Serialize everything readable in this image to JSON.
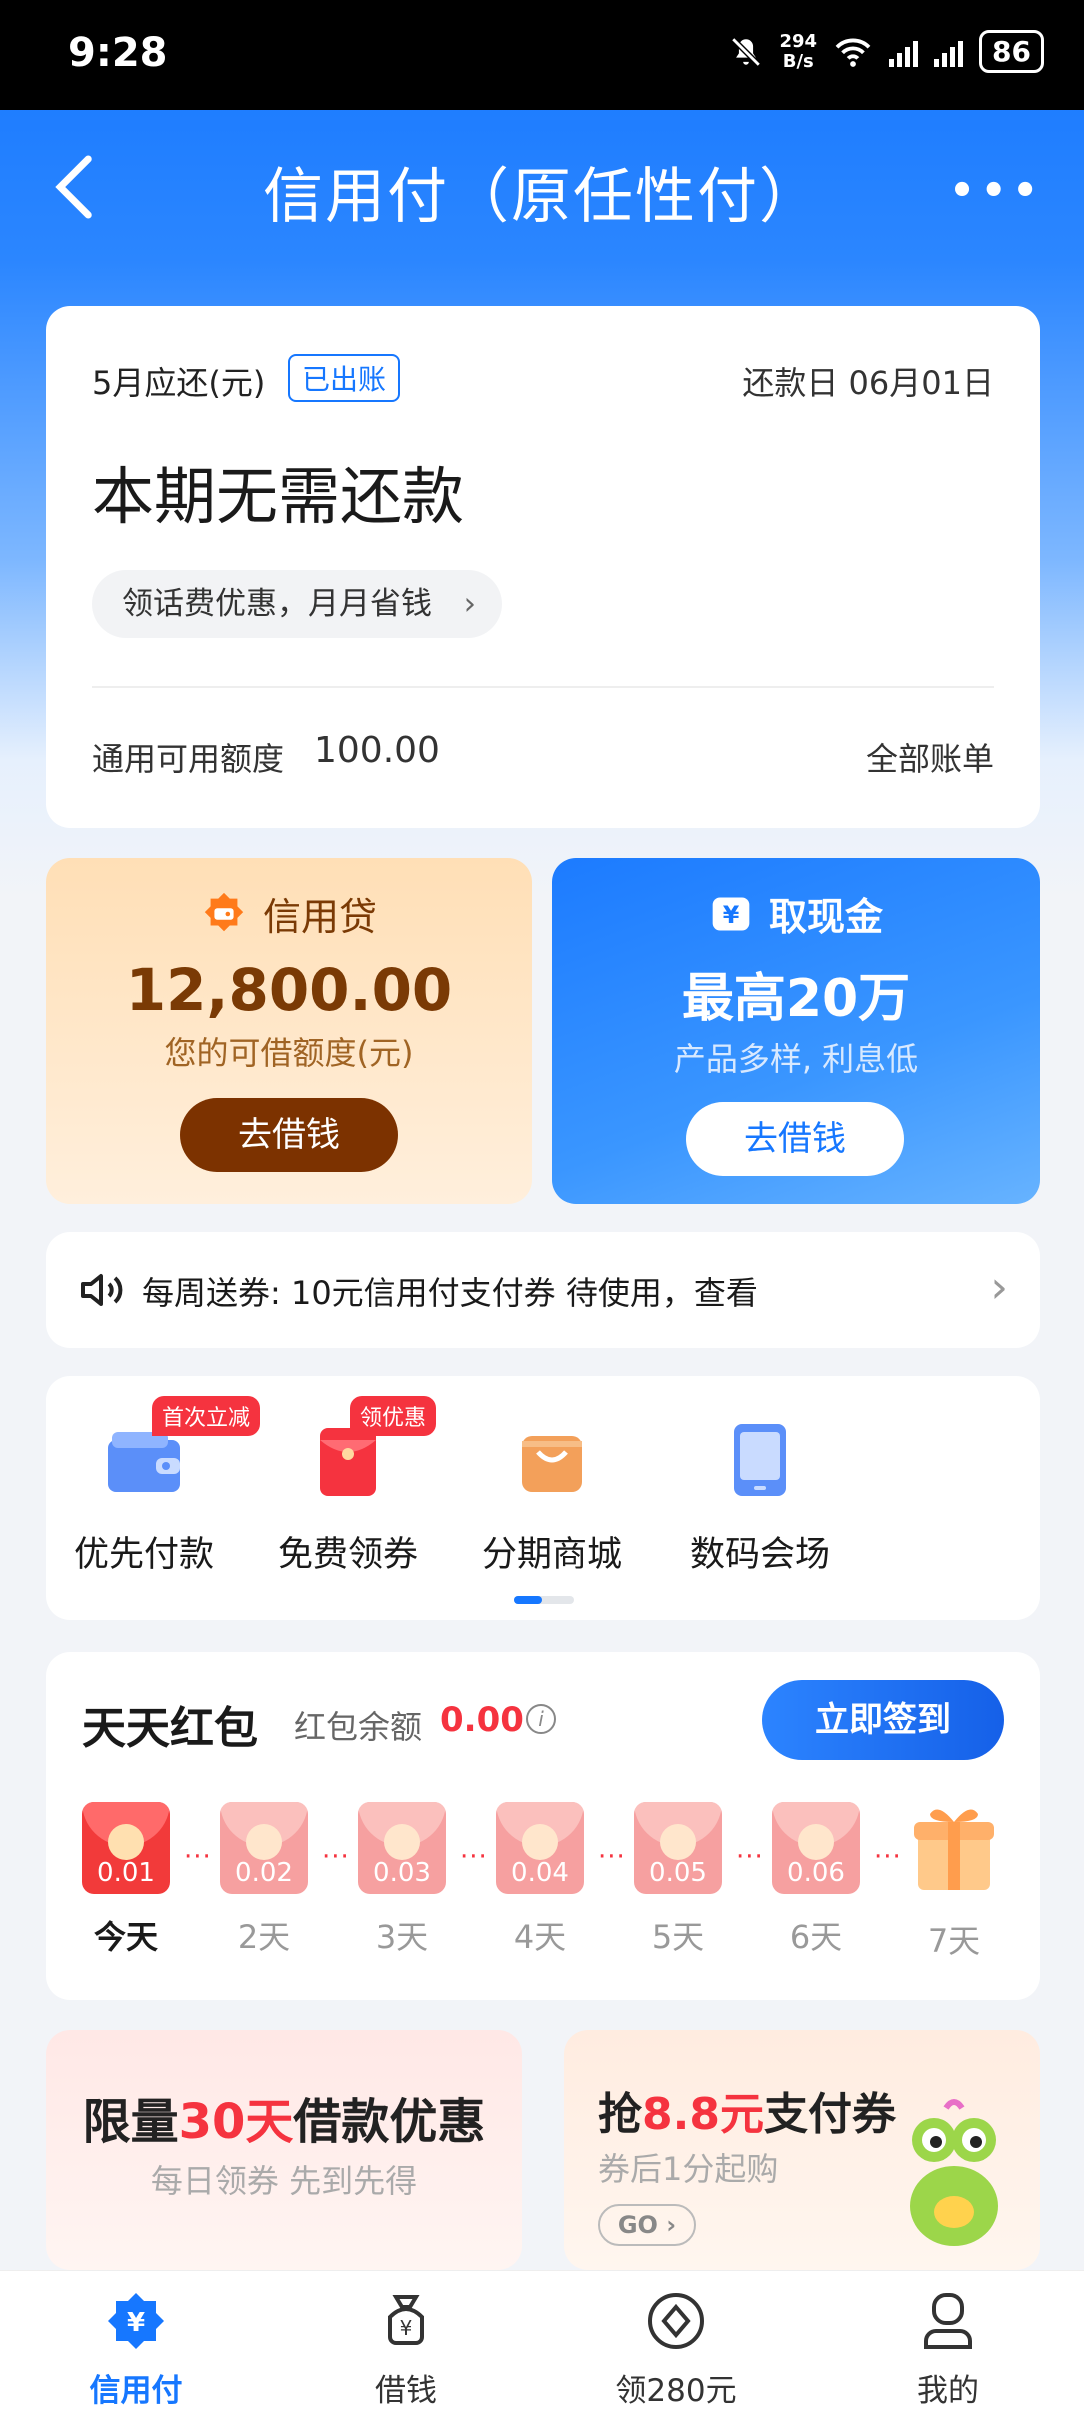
{
  "status_bar": {
    "time": "9:28",
    "net_speed_value": "294",
    "net_speed_unit": "B/s",
    "battery": "86"
  },
  "header": {
    "title": "信用付（原任性付）"
  },
  "bill": {
    "month_label": "5月应还(元)",
    "status_tag": "已出账",
    "due_date": "还款日 06月01日",
    "status_text": "本期无需还款",
    "promo_text": "领话费优惠，月月省钱",
    "available_label": "通用可用额度",
    "available_value": "100.00",
    "all_bills_label": "全部账单"
  },
  "loans": {
    "credit_loan": {
      "title": "信用贷",
      "amount": "12,800.00",
      "subtitle": "您的可借额度(元)",
      "button": "去借钱"
    },
    "cash": {
      "title": "取现金",
      "headline": "最高20万",
      "subtitle": "产品多样, 利息低",
      "button": "去借钱"
    }
  },
  "notice": {
    "text": "每周送券: 10元信用付支付券 待使用，查看"
  },
  "services": [
    {
      "label": "优先付款",
      "badge": "首次立减",
      "icon": "wallet-icon"
    },
    {
      "label": "免费领券",
      "badge": "领优惠",
      "icon": "red-envelope-icon"
    },
    {
      "label": "分期商城",
      "badge": "",
      "icon": "shopping-bag-icon"
    },
    {
      "label": "数码会场",
      "badge": "",
      "icon": "tablet-icon"
    }
  ],
  "red_packet": {
    "title": "天天红包",
    "balance_label": "红包余额",
    "balance_value": "0.00",
    "signin_button": "立即签到",
    "days": [
      {
        "amount": "0.01",
        "label": "今天"
      },
      {
        "amount": "0.02",
        "label": "2天"
      },
      {
        "amount": "0.03",
        "label": "3天"
      },
      {
        "amount": "0.04",
        "label": "4天"
      },
      {
        "amount": "0.05",
        "label": "5天"
      },
      {
        "amount": "0.06",
        "label": "6天"
      },
      {
        "amount": "",
        "label": "7天"
      }
    ]
  },
  "promos": {
    "left": {
      "title_prefix": "限量",
      "title_highlight": "30天",
      "title_suffix": "借款优惠",
      "subtitle": "每日领券 先到先得"
    },
    "right": {
      "title_prefix": "抢",
      "title_highlight": "8.8元",
      "title_suffix": "支付券",
      "subtitle": "券后1分起购",
      "go": "GO"
    }
  },
  "tabbar": [
    {
      "label": "信用付",
      "icon": "credit-pay-icon",
      "active": true
    },
    {
      "label": "借钱",
      "icon": "money-bag-icon",
      "active": false
    },
    {
      "label": "领280元",
      "icon": "coin-icon",
      "active": false
    },
    {
      "label": "我的",
      "icon": "profile-icon",
      "active": false
    }
  ],
  "colors": {
    "brand_blue": "#1677ff",
    "accent_red": "#f5333f",
    "loan_brown": "#7c3200"
  }
}
